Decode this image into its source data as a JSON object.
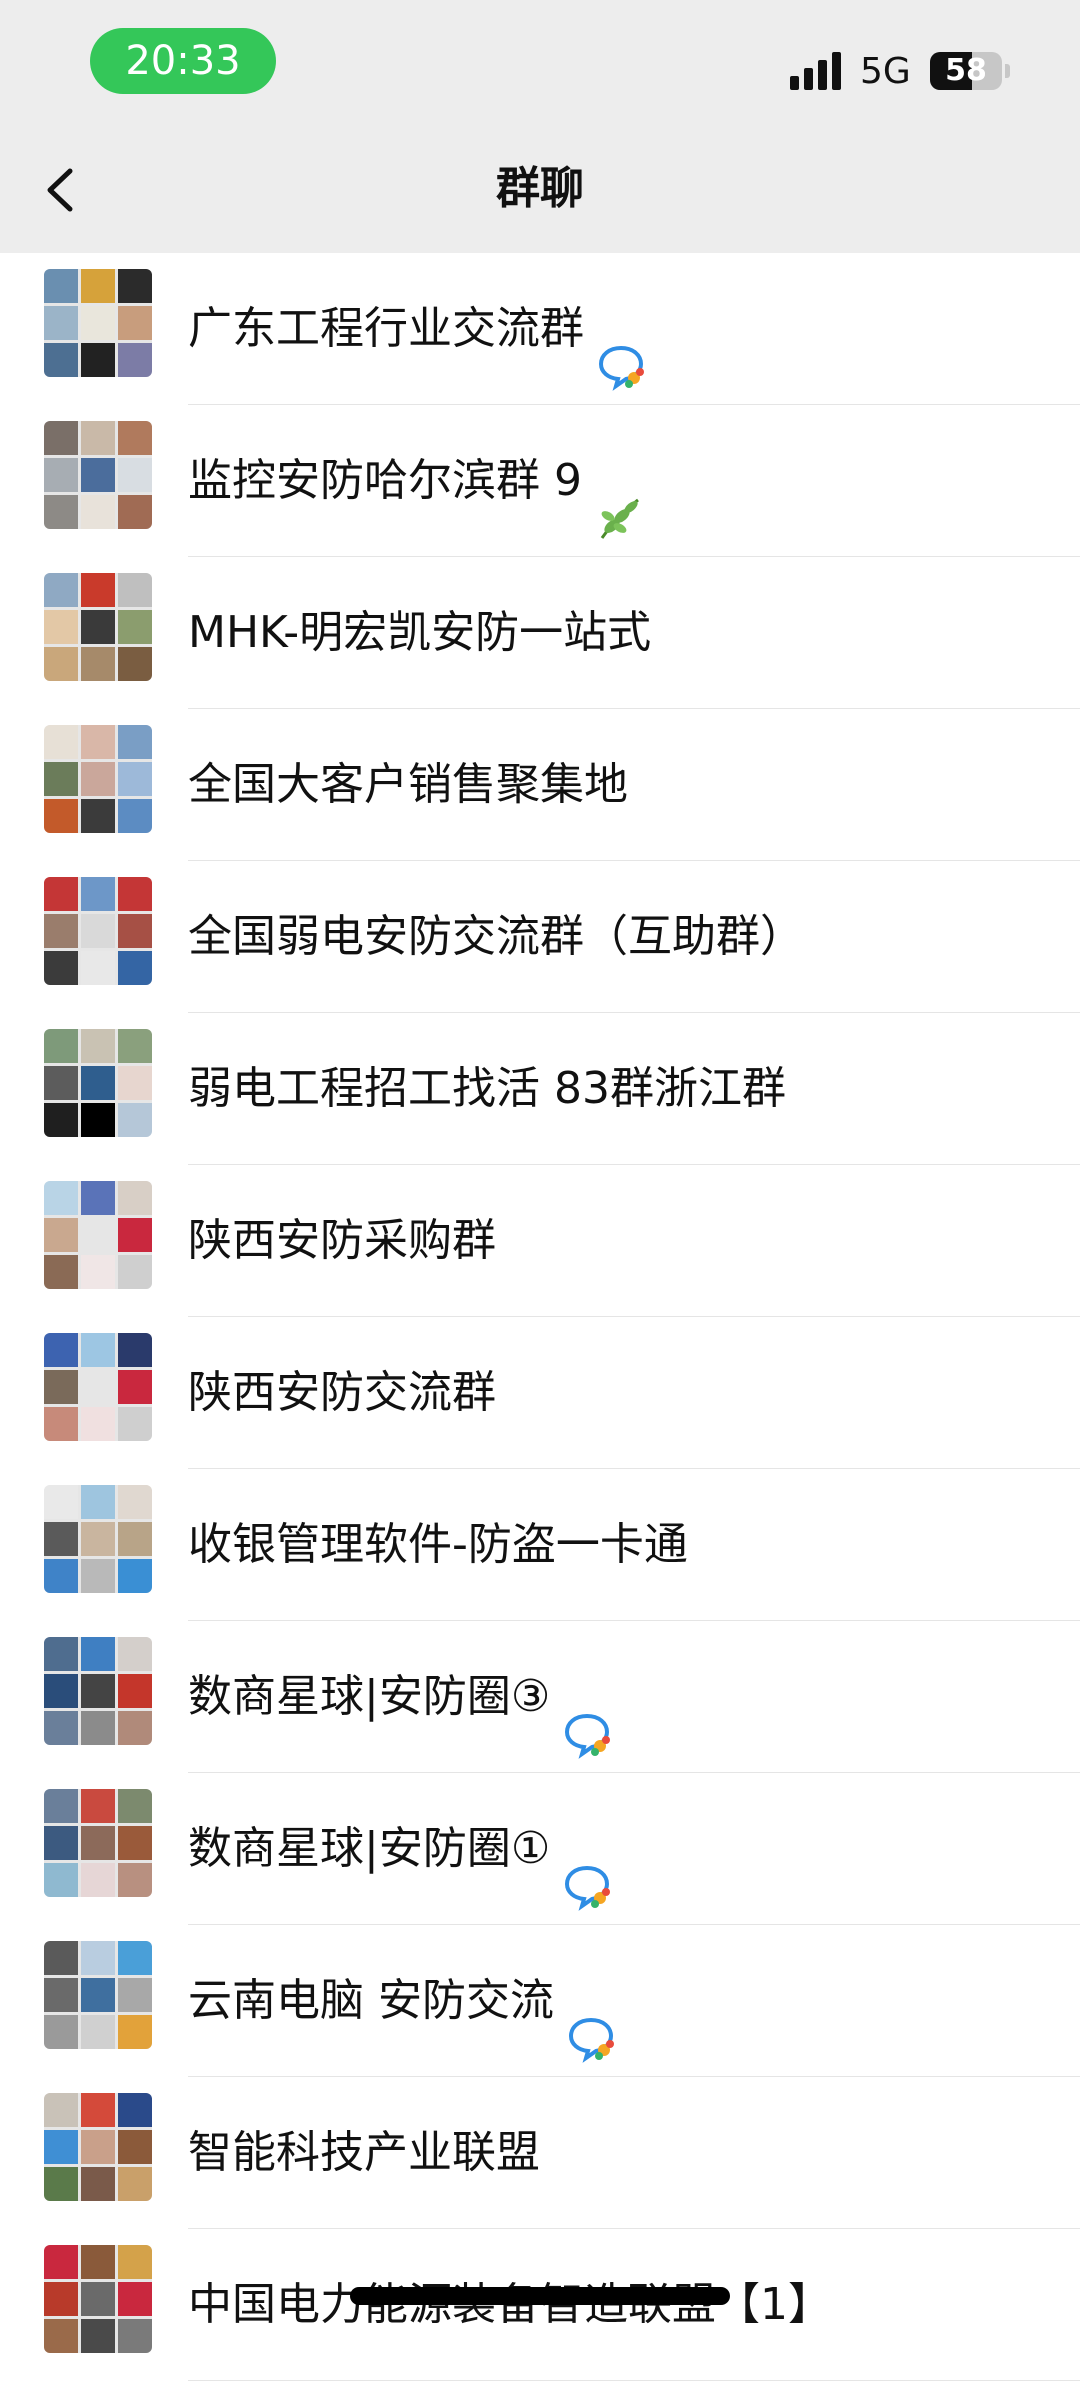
{
  "status": {
    "time": "20:33",
    "network": "5G",
    "battery": "58",
    "battery_level": 0.58
  },
  "nav": {
    "title": "群聊",
    "back_icon": "chevron-left-icon"
  },
  "groups": [
    {
      "name": "广东工程行业交流群",
      "badge": "chat-bubble-icon",
      "avatar_colors": [
        "#6a8fb0",
        "#d6a23a",
        "#2b2b2b",
        "#9bb4c8",
        "#e9e6dc",
        "#c89d7d",
        "#4d6f92",
        "#222",
        "#7c7ca6"
      ]
    },
    {
      "name": "监控安防哈尔滨群 9",
      "badge": "leaf-emoji",
      "avatar_colors": [
        "#7a6f68",
        "#c9b9a8",
        "#b07a5d",
        "#a7adb3",
        "#4b6d9c",
        "#d8dde2",
        "#8d8a86",
        "#e8e2da",
        "#a06b54"
      ]
    },
    {
      "name": "MHK-明宏凯安防一站式",
      "badge": "",
      "avatar_colors": [
        "#8fa9c3",
        "#c93a2b",
        "#bfbfbf",
        "#e3c8a6",
        "#3a3a3a",
        "#8b9d6e",
        "#c9a77b",
        "#a68a6a",
        "#7a5d41"
      ]
    },
    {
      "name": "全国大客户销售聚集地",
      "badge": "",
      "avatar_colors": [
        "#e7e0d6",
        "#d9b7a8",
        "#7a9ec5",
        "#6b7c5a",
        "#caa79b",
        "#9db9d9",
        "#c35a2a",
        "#3b3b3b",
        "#5c8cc2"
      ]
    },
    {
      "name": "全国弱电安防交流群（互助群）",
      "badge": "",
      "avatar_colors": [
        "#c43636",
        "#6d97c8",
        "#c43636",
        "#9a7d6c",
        "#d9d9d9",
        "#a65045",
        "#3b3b3b",
        "#e8e8e8",
        "#3465a4"
      ]
    },
    {
      "name": "弱电工程招工找活 83群浙江群",
      "badge": "",
      "avatar_colors": [
        "#7e9a7a",
        "#c9c2b3",
        "#8aa07d",
        "#5c5c5c",
        "#2f5e8e",
        "#e7d6cf",
        "#1f1f1f",
        "#000000",
        "#b5c7d8"
      ]
    },
    {
      "name": "陕西安防采购群",
      "badge": "",
      "avatar_colors": [
        "#b9d4e6",
        "#5a73b8",
        "#d8cfc6",
        "#c9a88f",
        "#e6e6e6",
        "#c9283e",
        "#8a6a55",
        "#f0e6e6",
        "#cfcfcf"
      ]
    },
    {
      "name": "陕西安防交流群",
      "badge": "",
      "avatar_colors": [
        "#3d63b0",
        "#9dc6e3",
        "#2a3a6b",
        "#7a6a5a",
        "#e6e6e6",
        "#c9283e",
        "#c78a7a",
        "#f0e0e0",
        "#cfcfcf"
      ]
    },
    {
      "name": "收银管理软件-防盗一卡通",
      "badge": "",
      "avatar_colors": [
        "#e9e9e9",
        "#9ec5df",
        "#e0d8d0",
        "#5a5a5a",
        "#c9b59f",
        "#b8a488",
        "#3f83c8",
        "#b9b9b9",
        "#3a8fd4"
      ]
    },
    {
      "name": "数商星球|安防圈③",
      "badge": "chat-bubble-icon",
      "avatar_colors": [
        "#4f6d8f",
        "#3f7fc2",
        "#d4cfcb",
        "#2a4d7a",
        "#444",
        "#c4362b",
        "#6a7f9a",
        "#8b8b8b",
        "#b08a7a"
      ]
    },
    {
      "name": "数商星球|安防圈①",
      "badge": "chat-bubble-icon",
      "avatar_colors": [
        "#6a7f9a",
        "#c94a3f",
        "#7c8a6e",
        "#3c5a80",
        "#8c6a5a",
        "#9a5a3a",
        "#8fb9d0",
        "#e6d6d6",
        "#b89080"
      ]
    },
    {
      "name": "云南电脑 安防交流",
      "badge": "chat-bubble-icon",
      "avatar_colors": [
        "#5a5a5a",
        "#b9cde0",
        "#4a9fd8",
        "#6a6a6a",
        "#3f6f9f",
        "#a8a8a8",
        "#9a9a9a",
        "#d0d0d0",
        "#e2a23a"
      ]
    },
    {
      "name": "智能科技产业联盟",
      "badge": "",
      "avatar_colors": [
        "#c9c2b8",
        "#d44a3a",
        "#2a4a8a",
        "#3f8fd4",
        "#c9a08a",
        "#8b5a3a",
        "#5a7a4a",
        "#7a5a4a",
        "#c9a06a"
      ]
    },
    {
      "name": "中国电力能源装备智造联盟【1】",
      "badge": "",
      "avatar_colors": [
        "#c9283e",
        "#8a5a3a",
        "#d4a24a",
        "#b83a2a",
        "#6a6a6a",
        "#c9283e",
        "#9a6a4a",
        "#4a4a4a",
        "#7a7a7a"
      ]
    }
  ]
}
